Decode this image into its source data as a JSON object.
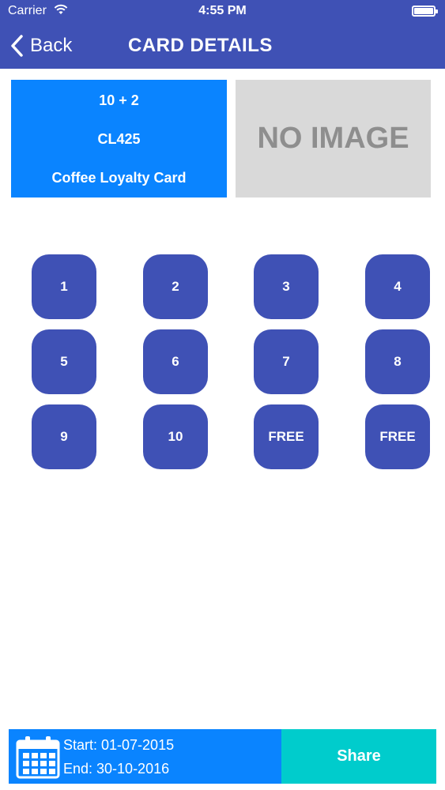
{
  "status_bar": {
    "carrier": "Carrier",
    "time": "4:55 PM",
    "wifi_icon": "wifi-icon",
    "battery_icon": "battery-icon"
  },
  "nav": {
    "back_label": "Back",
    "title": "CARD DETAILS",
    "back_icon": "chevron-left-icon"
  },
  "card": {
    "offer": "10 + 2",
    "code": "CL425",
    "name": "Coffee Loyalty Card",
    "image_placeholder": "NO IMAGE"
  },
  "stamps": [
    "1",
    "2",
    "3",
    "4",
    "5",
    "6",
    "7",
    "8",
    "9",
    "10",
    "FREE",
    "FREE"
  ],
  "footer": {
    "calendar_icon": "calendar-icon",
    "start": "Start: 01-07-2015",
    "end": "End: 30-10-2016",
    "share_label": "Share"
  },
  "colors": {
    "primary": "#3F51B5",
    "card_blue": "#0A84FF",
    "share_teal": "#00CCCC",
    "placeholder_gray": "#D9D9D9"
  }
}
